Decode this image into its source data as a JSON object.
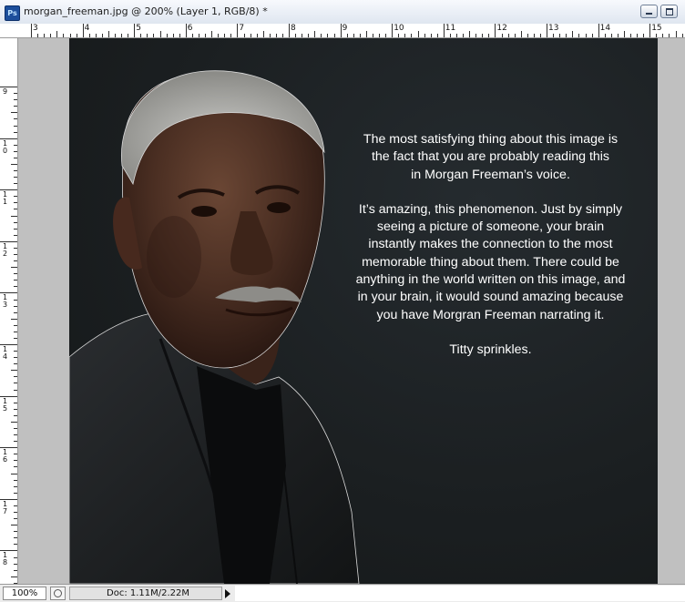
{
  "window": {
    "title": "morgan_freeman.jpg @ 200% (Layer 1, RGB/8) *",
    "app_icon": "Ps",
    "controls": [
      "minimize-icon",
      "maximize-icon"
    ]
  },
  "rulers": {
    "horizontal_labels": [
      "3",
      "4",
      "5",
      "6",
      "7",
      "8",
      "9",
      "10",
      "11",
      "12",
      "13",
      "14",
      "15"
    ],
    "vertical_labels": [
      "9",
      "10",
      "11",
      "12",
      "13",
      "14",
      "15",
      "16",
      "17",
      "18"
    ]
  },
  "canvas": {
    "caption": {
      "paragraph1": [
        "The most satisfying thing about this image is",
        "the fact that you are probably reading this",
        "in Morgan Freeman’s voice."
      ],
      "paragraph2": [
        "It’s amazing, this phenomenon. Just by simply",
        "seeing a picture of someone, your brain",
        "instantly makes the connection to the most",
        "memorable thing about them. There could be",
        "anything in the world written on this image, and",
        "in your brain, it would sound amazing because",
        "you have Morgran Freeman narrating it."
      ],
      "paragraph3": [
        "Titty sprinkles."
      ]
    }
  },
  "statusbar": {
    "zoom": "100%",
    "doc_info": "Doc: 1.11M/2.22M"
  },
  "colors": {
    "canvas_background": "#1b1f21",
    "pasteboard": "#c0c0c0",
    "caption_text": "#ffffff"
  }
}
